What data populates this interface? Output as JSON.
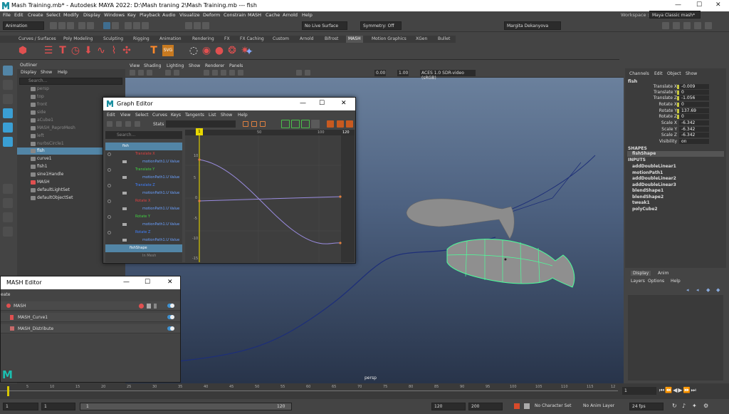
{
  "window": {
    "title": "Mash Training.mb* - Autodesk MAYA 2022: D:\\Mash  traning 2\\Mash Training.mb   ---   fish"
  },
  "menubar": [
    "File",
    "Edit",
    "Create",
    "Select",
    "Modify",
    "Display",
    "Windows",
    "Key",
    "Playback",
    "Audio",
    "Visualize",
    "Deform",
    "Constrain",
    "MASH",
    "Cache",
    "Arnold",
    "Help"
  ],
  "workspace": {
    "label": "Workspace :",
    "value": "Maya Classic mash*"
  },
  "status": {
    "menuset": "Animation",
    "live_surface": "No Live Surface",
    "symmetry": "Symmetry: Off",
    "user": "Margita Dekanyova"
  },
  "shelf_tabs": [
    "Curves / Surfaces",
    "Poly Modeling",
    "Sculpting",
    "Rigging",
    "Animation",
    "Rendering",
    "FX",
    "FX Caching",
    "Custom",
    "Arnold",
    "Bifrost",
    "MASH",
    "Motion Graphics",
    "XGen",
    "Bullet"
  ],
  "shelf_active": "MASH",
  "outliner": {
    "title": "Outliner",
    "menu": [
      "Display",
      "Show",
      "Help"
    ],
    "search_placeholder": "Search...",
    "items": [
      "persp",
      "top",
      "front",
      "side",
      "aCube1",
      "MASH_ReproMesh",
      "left",
      "nurbsCircle1",
      "fish",
      "curve1",
      "fish1",
      "sine1Handle",
      "MASH",
      "defaultLightSet",
      "defaultObjectSet"
    ]
  },
  "viewport": {
    "menu": [
      "View",
      "Shading",
      "Lighting",
      "Show",
      "Renderer",
      "Panels"
    ],
    "val1": "0.00",
    "val2": "1.00",
    "colorspace": "ACES 1.0 SDR-video (sRGB)",
    "camera": "persp"
  },
  "graph_editor": {
    "title": "Graph Editor",
    "menu": [
      "Edit",
      "View",
      "Select",
      "Curves",
      "Keys",
      "Tangents",
      "List",
      "Show",
      "Help"
    ],
    "stats": "Stats",
    "search_placeholder": "Search...",
    "ruler": [
      "1",
      "50",
      "100",
      "120"
    ],
    "yticks": [
      "10",
      "5",
      "0",
      "-5",
      "-10",
      "-15"
    ],
    "current_frame": "1",
    "items": [
      {
        "label": "fish",
        "color": "#ffffff"
      },
      {
        "label": "Translate X",
        "color": "#e04040"
      },
      {
        "label": "motionPath1.U Value",
        "color": "#6aa0ff"
      },
      {
        "label": "Translate Y",
        "color": "#40d040"
      },
      {
        "label": "motionPath1.U Value",
        "color": "#6aa0ff"
      },
      {
        "label": "Translate Z",
        "color": "#4080ff"
      },
      {
        "label": "motionPath1.U Value",
        "color": "#6aa0ff"
      },
      {
        "label": "Rotate X",
        "color": "#e04040"
      },
      {
        "label": "motionPath1.U Value",
        "color": "#6aa0ff"
      },
      {
        "label": "Rotate Y",
        "color": "#40d040"
      },
      {
        "label": "motionPath1.U Value",
        "color": "#6aa0ff"
      },
      {
        "label": "Rotate Z",
        "color": "#4080ff"
      },
      {
        "label": "motionPath1.U Value",
        "color": "#6aa0ff"
      },
      {
        "label": "fishShape",
        "color": "#ffffff"
      },
      {
        "label": "In Mesh",
        "color": "#888888"
      }
    ]
  },
  "mash_editor": {
    "title": "MASH Editor",
    "create": "eate",
    "rows": [
      "MASH",
      "MASH_Curve1",
      "MASH_Distribute"
    ]
  },
  "channel_box": {
    "menu": [
      "Channels",
      "Edit",
      "Object",
      "Show"
    ],
    "object": "fish",
    "channels": [
      {
        "name": "Translate X",
        "value": "-0.009"
      },
      {
        "name": "Translate Y",
        "value": "0"
      },
      {
        "name": "Translate Z",
        "value": "-1.056"
      },
      {
        "name": "Rotate X",
        "value": "0"
      },
      {
        "name": "Rotate Y",
        "value": "137.69"
      },
      {
        "name": "Rotate Z",
        "value": "0"
      },
      {
        "name": "Scale X",
        "value": "-6.342"
      },
      {
        "name": "Scale Y",
        "value": "-6.342"
      },
      {
        "name": "Scale Z",
        "value": "-6.342"
      },
      {
        "name": "Visibility",
        "value": "on"
      }
    ],
    "shapes_label": "SHAPES",
    "shape": "fishShape",
    "inputs_label": "INPUTS",
    "inputs": [
      "addDoubleLinear1",
      "motionPath1",
      "addDoubleLinear2",
      "addDoubleLinear3",
      "blendShape1",
      "blendShape2",
      "tweak1",
      "polyCube2"
    ]
  },
  "layer_editor": {
    "tabs": [
      "Display",
      "Anim"
    ],
    "menu": [
      "Layers",
      "Options",
      "Help"
    ]
  },
  "timeline": {
    "ticks": [
      "5",
      "10",
      "15",
      "20",
      "25",
      "30",
      "35",
      "40",
      "45",
      "50",
      "55",
      "60",
      "65",
      "70",
      "75",
      "80",
      "85",
      "90",
      "95",
      "100",
      "105",
      "110",
      "115",
      "12"
    ],
    "current": "1"
  },
  "range": {
    "start": "1",
    "start2": "1",
    "slider_start": "1",
    "slider_end": "120",
    "end": "120",
    "end2": "200",
    "char_set": "No Character Set",
    "anim_layer": "No Anim Layer",
    "fps": "24 fps"
  }
}
